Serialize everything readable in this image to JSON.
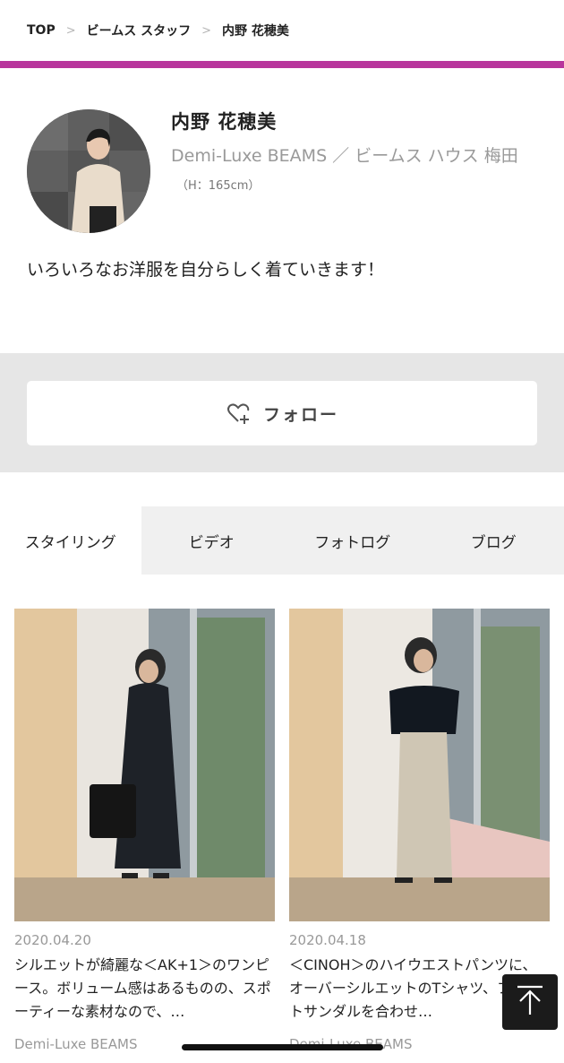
{
  "breadcrumb": [
    {
      "label": "TOP"
    },
    {
      "label": "ビームス スタッフ"
    },
    {
      "label": "内野 花穂美"
    }
  ],
  "breadcrumb_separator": ">",
  "accent_color": "#b8359c",
  "profile": {
    "name": "内野 花穂美",
    "affiliation": "Demi-Luxe BEAMS ／ ビームス ハウス 梅田",
    "height": "（H：165cm）",
    "bio": "いろいろなお洋服を自分らしく着ていきます！"
  },
  "follow": {
    "label": "フォロー",
    "icon": "heart-plus-icon"
  },
  "tabs": [
    {
      "label": "スタイリング",
      "active": true
    },
    {
      "label": "ビデオ",
      "active": false
    },
    {
      "label": "フォトログ",
      "active": false
    },
    {
      "label": "ブログ",
      "active": false
    }
  ],
  "posts": [
    {
      "date": "2020.04.20",
      "caption": "シルエットが綺麗な＜AK+1＞のワンピース。ボリューム感はあるものの、スポーティーな素材なので、…",
      "brand": "Demi-Luxe BEAMS"
    },
    {
      "date": "2020.04.18",
      "caption": "＜CINOH＞のハイウエストパンツに、オーバーシルエットのTシャツ、フラットサンダルを合わせ…",
      "brand": "Demi-Luxe BEAMS"
    }
  ],
  "back_to_top_icon": "arrow-up-icon"
}
